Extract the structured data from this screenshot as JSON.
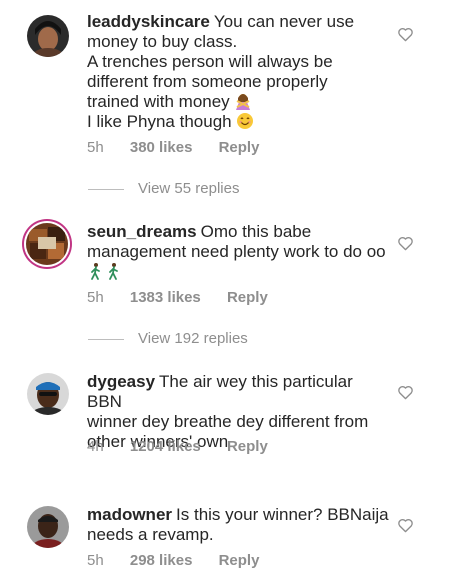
{
  "comments": [
    {
      "username": "leaddyskincare",
      "lines": [
        "You can never use",
        "money to buy class.",
        "A trenches person will always be",
        "different from someone properly",
        "trained with money",
        "I like Phyna though"
      ],
      "time": "5h",
      "likes": "380 likes",
      "reply": "Reply",
      "view_replies": "View 55 replies",
      "emoji_1": "woman-gesturing-no-emoji",
      "emoji_2": "smiling-face-emoji"
    },
    {
      "username": "seun_dreams",
      "lines": [
        "Omo this babe",
        "management need plenty work to do oo"
      ],
      "time": "5h",
      "likes": "1383 likes",
      "reply": "Reply",
      "view_replies": "View 192 replies",
      "emoji_1": "person-walking-emoji"
    },
    {
      "username": "dygeasy",
      "lines": [
        "The air wey this particular BBN",
        "winner dey breathe dey different from",
        "other winners' own"
      ],
      "time": "4h",
      "likes": "1204 likes",
      "reply": "Reply"
    },
    {
      "username": "madowner",
      "lines": [
        "Is this your winner? BBNaija",
        "needs a revamp."
      ],
      "time": "5h",
      "likes": "298 likes",
      "reply": "Reply"
    }
  ],
  "colors": {
    "text": "#262626",
    "muted": "#8e8e8e",
    "story_ring": "#c13584"
  }
}
